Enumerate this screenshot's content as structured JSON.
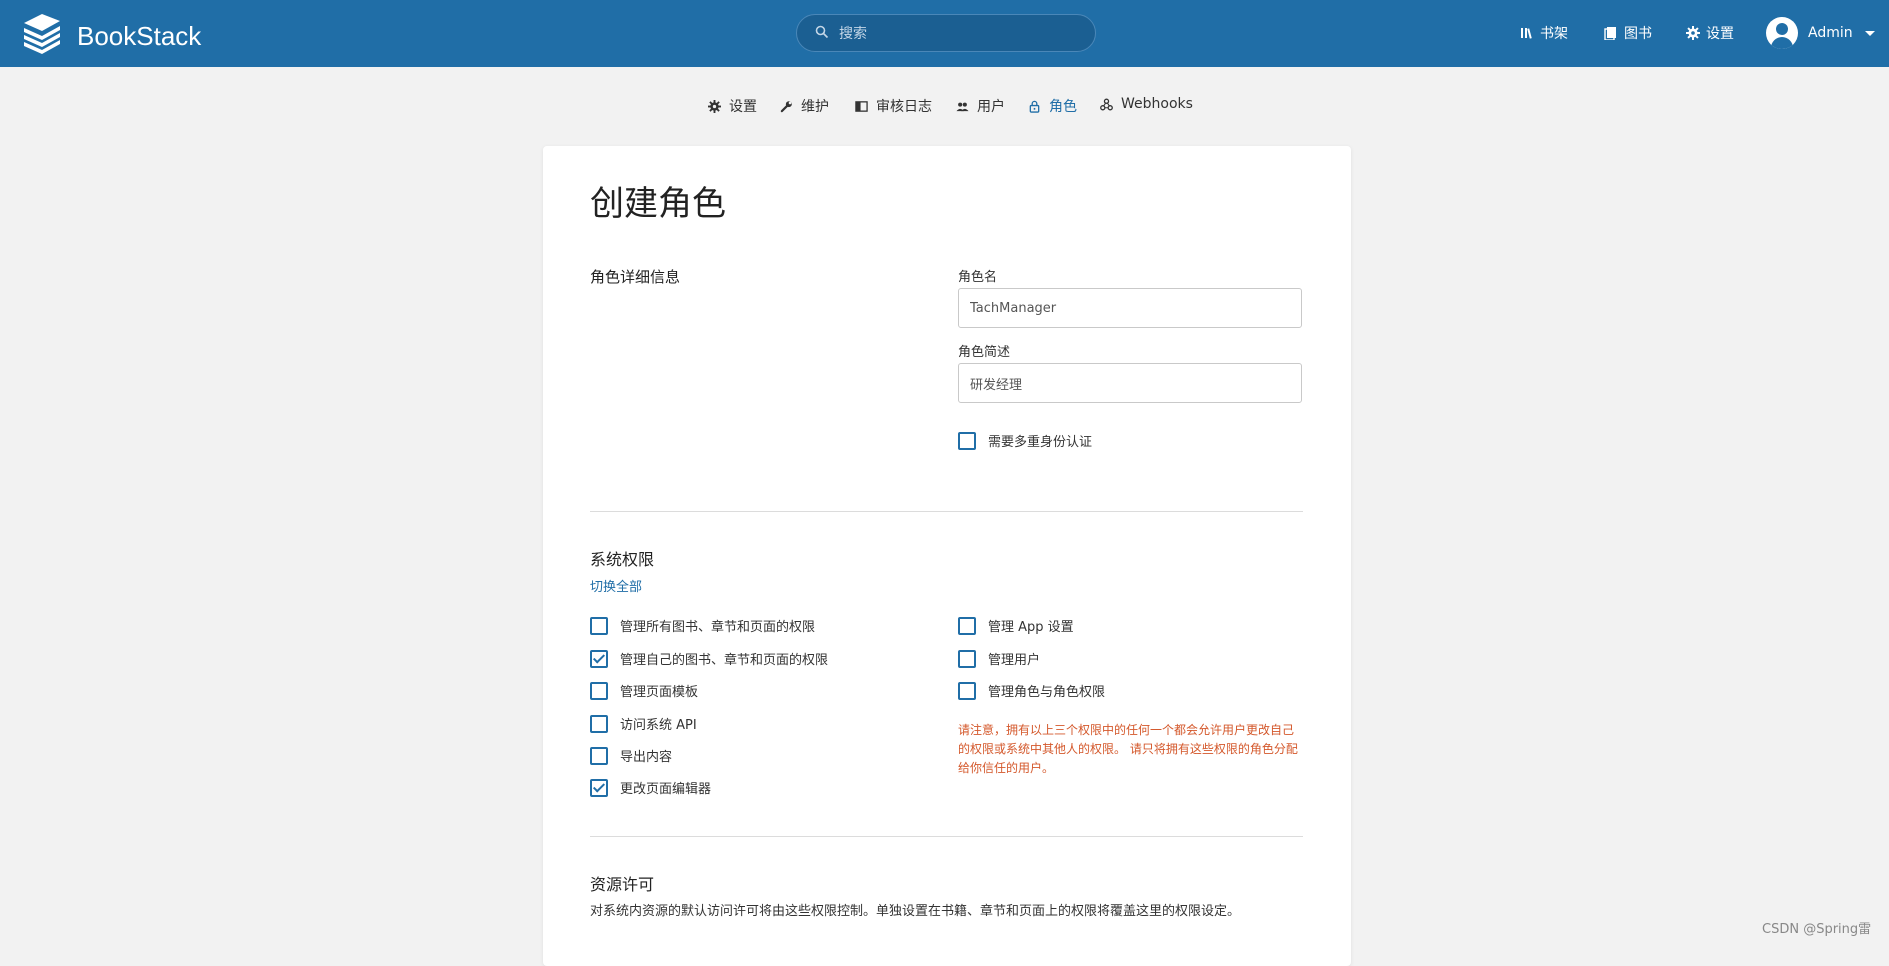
{
  "header": {
    "app_name": "BookStack",
    "search_placeholder": "搜索",
    "nav": {
      "shelves": "书架",
      "books": "图书",
      "settings": "设置"
    },
    "user_name": "Admin"
  },
  "settings_tabs": [
    {
      "label": "设置",
      "icon": "gear-icon"
    },
    {
      "label": "维护",
      "icon": "wrench-icon"
    },
    {
      "label": "审核日志",
      "icon": "audit-log-icon"
    },
    {
      "label": "用户",
      "icon": "users-icon"
    },
    {
      "label": "角色",
      "icon": "lock-icon",
      "active": true
    },
    {
      "label": "Webhooks",
      "icon": "webhook-icon"
    }
  ],
  "page_title": "创建角色",
  "role_details": {
    "heading": "角色详细信息",
    "name_label": "角色名",
    "name_value": "TachManager",
    "description_label": "角色简述",
    "description_value": "研发经理",
    "mfa_label": "需要多重身份认证",
    "mfa_checked": false
  },
  "system_permissions": {
    "heading": "系统权限",
    "toggle_all": "切换全部",
    "left": [
      {
        "label": "管理所有图书、章节和页面的权限",
        "checked": false
      },
      {
        "label": "管理自己的图书、章节和页面的权限",
        "checked": true
      },
      {
        "label": "管理页面模板",
        "checked": false
      },
      {
        "label": "访问系统 API",
        "checked": false
      },
      {
        "label": "导出内容",
        "checked": false
      },
      {
        "label": "更改页面编辑器",
        "checked": true
      }
    ],
    "right": [
      {
        "label": "管理 App 设置",
        "checked": false
      },
      {
        "label": "管理用户",
        "checked": false
      },
      {
        "label": "管理角色与角色权限",
        "checked": false
      }
    ],
    "warning": "请注意，拥有以上三个权限中的任何一个都会允许用户更改自己的权限或系统中其他人的权限。 请只将拥有这些权限的角色分配给你信任的用户。"
  },
  "asset_permissions": {
    "heading": "资源许可",
    "description": "对系统内资源的默认访问许可将由这些权限控制。单独设置在书籍、章节和页面上的权限将覆盖这里的权限设定。"
  },
  "watermark": "CSDN @Spring雷",
  "colors": {
    "primary": "#206ea7",
    "warning": "#d4582b",
    "background": "#f2f2f2"
  }
}
